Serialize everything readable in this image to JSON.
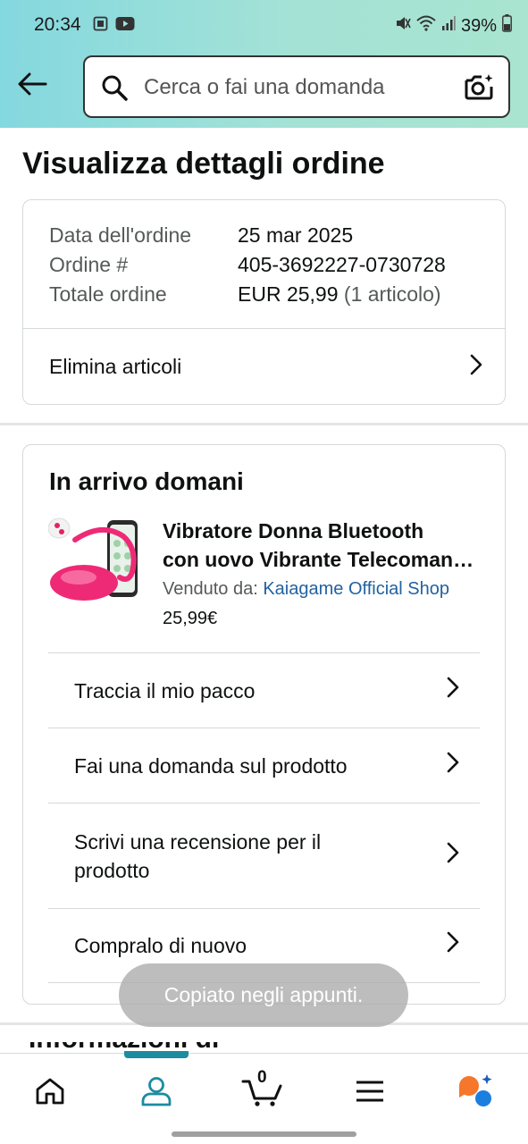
{
  "status_bar": {
    "time": "20:34",
    "battery": "39%",
    "icons": [
      "gallery-icon",
      "youtube-icon",
      "mute-icon",
      "wifi-icon",
      "signal-icon",
      "battery-icon"
    ]
  },
  "header": {
    "back_icon": "back-arrow-icon",
    "search_placeholder": "Cerca o fai una domanda",
    "camera_icon": "camera-search-icon"
  },
  "page_title": "Visualizza dettagli ordine",
  "summary": {
    "rows": [
      {
        "label": "Data dell'ordine",
        "value": "25 mar 2025"
      },
      {
        "label": "Ordine #",
        "value": "405-3692227-0730728"
      },
      {
        "label": "Totale ordine",
        "value": "EUR 25,99",
        "extra": "(1 articolo)"
      }
    ],
    "action_label": "Elimina articoli"
  },
  "shipment": {
    "heading": "In arrivo domani",
    "product": {
      "name_line1": "Vibratore Donna Bluetooth",
      "name_line2": "con uovo Vibrante Telecomando...",
      "seller_prefix": "Venduto da:",
      "seller_name": "Kaiagame Official Shop",
      "price": "25,99€"
    },
    "actions": [
      {
        "label": "Traccia il mio pacco"
      },
      {
        "label": "Fai una domanda sul prodotto"
      },
      {
        "label": "Scrivi una recensione per il prodotto"
      },
      {
        "label": "Compralo di nuovo"
      }
    ]
  },
  "next_section_title": "Informazioni di pagamento",
  "toast": "Copiato negli appunti.",
  "bottom_nav": {
    "items": [
      "home-icon",
      "account-icon",
      "cart-icon",
      "menu-icon",
      "rufus-icon"
    ],
    "cart_count": "0",
    "active": "account-icon",
    "accent": "#1d8ba0"
  },
  "colors": {
    "header_gradient_start": "#84d8df",
    "header_gradient_end": "#a8e4cf",
    "link": "#2162a1",
    "secondary_text": "#565959"
  }
}
